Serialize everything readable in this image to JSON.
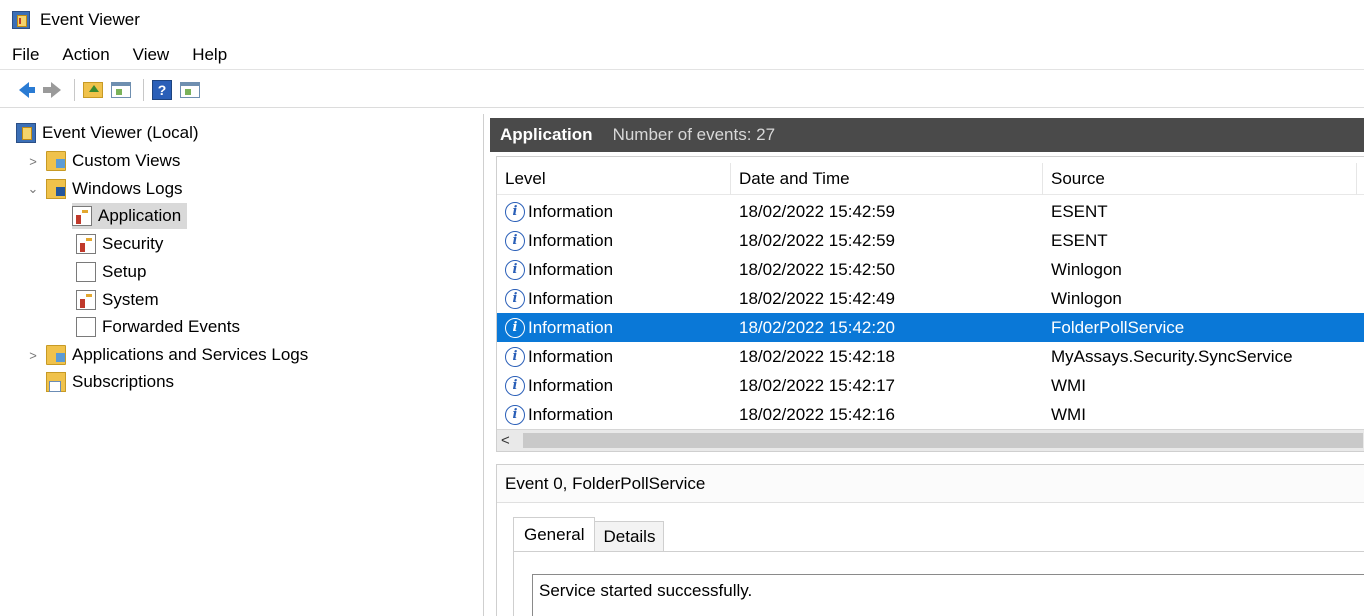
{
  "window": {
    "title": "Event Viewer"
  },
  "menu": [
    "File",
    "Action",
    "View",
    "Help"
  ],
  "tree": {
    "root": "Event Viewer (Local)",
    "custom_views": "Custom Views",
    "windows_logs": "Windows Logs",
    "application": "Application",
    "security": "Security",
    "setup": "Setup",
    "system": "System",
    "forwarded": "Forwarded Events",
    "apps_services": "Applications and Services Logs",
    "subscriptions": "Subscriptions"
  },
  "log_header": {
    "title": "Application",
    "count": "Number of events: 27"
  },
  "columns": {
    "level": "Level",
    "datetime": "Date and Time",
    "source": "Source"
  },
  "events": [
    {
      "level": "Information",
      "datetime": "18/02/2022 15:42:59",
      "source": "ESENT",
      "selected": false
    },
    {
      "level": "Information",
      "datetime": "18/02/2022 15:42:59",
      "source": "ESENT",
      "selected": false
    },
    {
      "level": "Information",
      "datetime": "18/02/2022 15:42:50",
      "source": "Winlogon",
      "selected": false
    },
    {
      "level": "Information",
      "datetime": "18/02/2022 15:42:49",
      "source": "Winlogon",
      "selected": false
    },
    {
      "level": "Information",
      "datetime": "18/02/2022 15:42:20",
      "source": "FolderPollService",
      "selected": true
    },
    {
      "level": "Information",
      "datetime": "18/02/2022 15:42:18",
      "source": "MyAssays.Security.SyncService",
      "selected": false
    },
    {
      "level": "Information",
      "datetime": "18/02/2022 15:42:17",
      "source": "WMI",
      "selected": false
    },
    {
      "level": "Information",
      "datetime": "18/02/2022 15:42:16",
      "source": "WMI",
      "selected": false
    }
  ],
  "scroll_left_glyph": "<",
  "detail": {
    "header": "Event 0, FolderPollService",
    "tabs": [
      "General",
      "Details"
    ],
    "message": "Service started successfully."
  },
  "colors": {
    "selection": "#0a78d7",
    "header_bar": "#4a4a4a"
  }
}
